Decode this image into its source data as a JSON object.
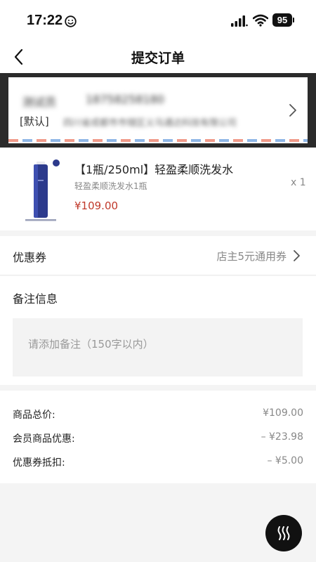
{
  "status_bar": {
    "time": "17:22",
    "battery": "95"
  },
  "nav": {
    "title": "提交订单"
  },
  "address": {
    "name": "测试员",
    "phone": "18758258180",
    "default_tag": "[默认]",
    "detail": "四川省成都市市辖区义乌通达科技有限公司"
  },
  "product": {
    "title": "【1瓶/250ml】轻盈柔顺洗发水",
    "spec": "轻盈柔顺洗发水1瓶",
    "quantity": "x 1",
    "price": "¥109.00",
    "image_label": "轻盈柔顺洗发水1瓶"
  },
  "coupon": {
    "label": "优惠券",
    "value": "店主5元通用券"
  },
  "remark": {
    "label": "备注信息",
    "placeholder": "请添加备注（150字以内）"
  },
  "summary": {
    "rows": [
      {
        "label": "商品总价:",
        "value": "¥109.00"
      },
      {
        "label": "会员商品优惠:",
        "value": "– ¥23.98"
      },
      {
        "label": "优惠券抵扣:",
        "value": "– ¥5.00"
      }
    ]
  },
  "colors": {
    "price_red": "#c0392b",
    "stripe_red": "#f09a8a",
    "stripe_blue": "#8fb6e6"
  },
  "icons": [
    "back-icon",
    "chevron-right-icon",
    "signal-icon",
    "wifi-icon",
    "battery-icon",
    "smiley-icon",
    "heat-waves-icon"
  ]
}
